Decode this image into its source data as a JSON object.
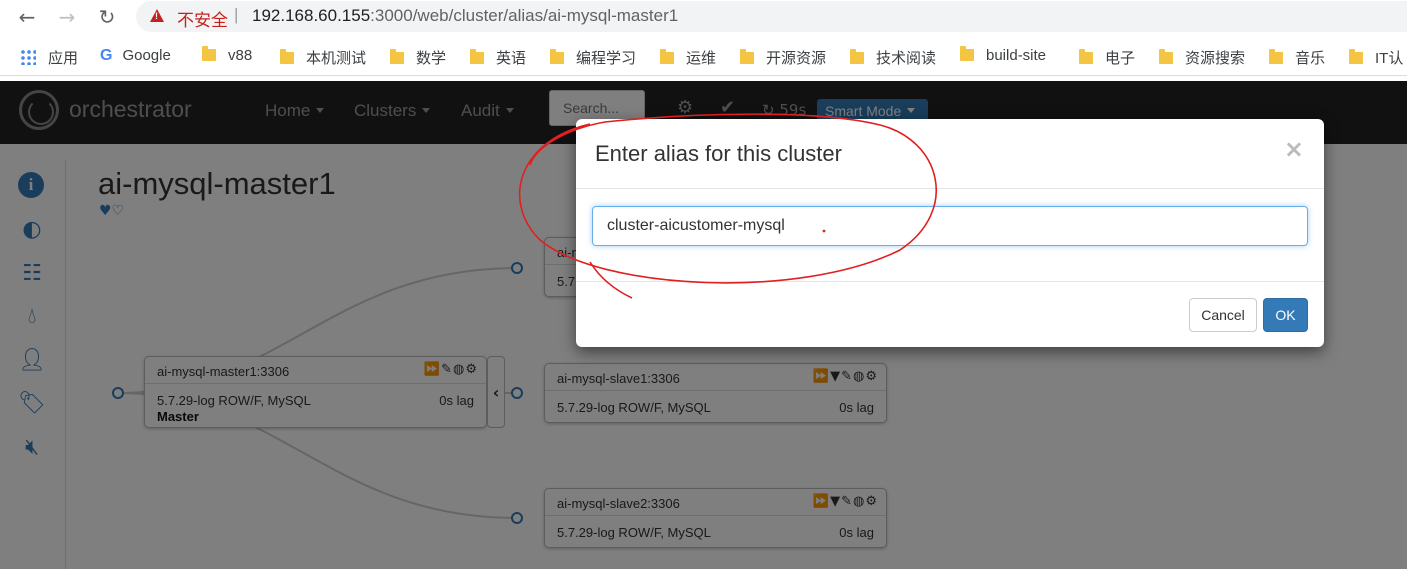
{
  "browser": {
    "security_label": "不安全",
    "url_host": "192.168.60.155",
    "url_rest": ":3000/web/cluster/alias/ai-mysql-master1",
    "bookmarks": [
      "应用",
      "Google",
      "v88",
      "本机测试",
      "数学",
      "英语",
      "编程学习",
      "运维",
      "开源资源",
      "技术阅读",
      "build-site",
      "电子",
      "资源搜索",
      "音乐",
      "IT认"
    ]
  },
  "navbar": {
    "brand": "orchestrator",
    "home": "Home",
    "clusters": "Clusters",
    "audit": "Audit",
    "search_placeholder": "Search...",
    "refresh": "59s",
    "mode": "Smart Mode"
  },
  "page": {
    "title": "ai-mysql-master1",
    "hearts": "♥♡"
  },
  "nodes": [
    {
      "name": "ai-mysql-master1:3306",
      "version": "5.7.29-log ROW/F, MySQL",
      "lag": "0s lag",
      "role": "Master"
    },
    {
      "name": "ai-mysql-slave1:3306",
      "version": "5.7.29-log ROW/F, MySQL",
      "lag": "0s lag"
    },
    {
      "name": "ai-mysql-slave2:3306",
      "version": "5.7.29-log ROW/F, MySQL",
      "lag": "0s lag"
    },
    {
      "name": "ai-m",
      "version": "5.7"
    }
  ],
  "modal": {
    "title": "Enter alias for this cluster",
    "close": "×",
    "input_value": "cluster-aicustomer-mysql",
    "cancel": "Cancel",
    "ok": "OK"
  }
}
